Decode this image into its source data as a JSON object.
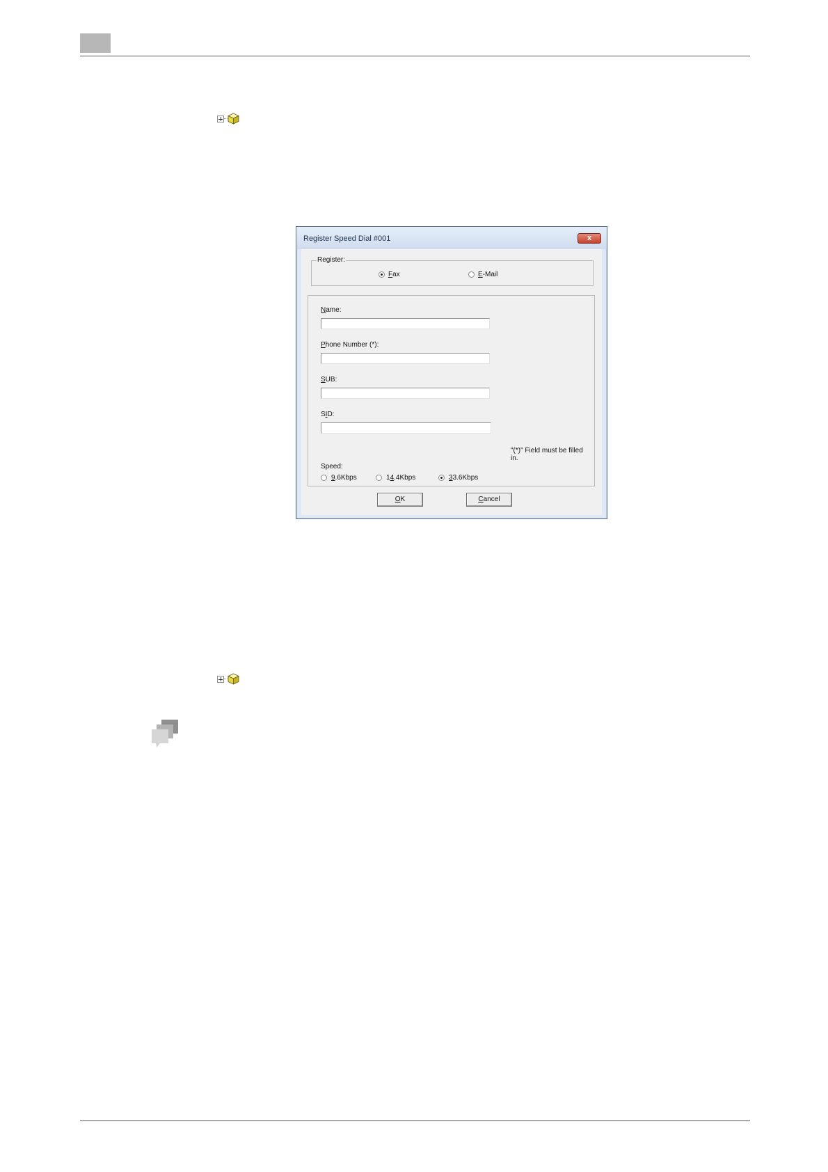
{
  "dialog": {
    "title": "Register Speed Dial #001",
    "close_glyph": "x",
    "register": {
      "legend": "Register:",
      "options": [
        {
          "label": "Fax",
          "selected": true
        },
        {
          "label": "E-Mail",
          "selected": false
        }
      ]
    },
    "fields": {
      "name": {
        "label": "Name:",
        "value": ""
      },
      "phone": {
        "label": "Phone Number (*):",
        "value": ""
      },
      "sub": {
        "label": "SUB:",
        "value": ""
      },
      "sid": {
        "label": "SID:",
        "value": ""
      }
    },
    "required_note": "\"(*)\" Field must be filled in.",
    "speed": {
      "label": "Speed:",
      "options": [
        {
          "label": "9.6Kbps",
          "selected": false
        },
        {
          "label": "14.4Kbps",
          "selected": false
        },
        {
          "label": "33.6Kbps",
          "selected": true
        }
      ]
    },
    "buttons": {
      "ok": "OK",
      "cancel": "Cancel"
    }
  },
  "icons": {
    "tree_item": "expand-plus-box-icon",
    "note": "speech-bubbles-icon"
  },
  "colors": {
    "header_block": "#b7b7b7",
    "dialog_frame": "#dfe9f5",
    "client_bg": "#f0f0f0",
    "close_button": "#c8422c"
  }
}
